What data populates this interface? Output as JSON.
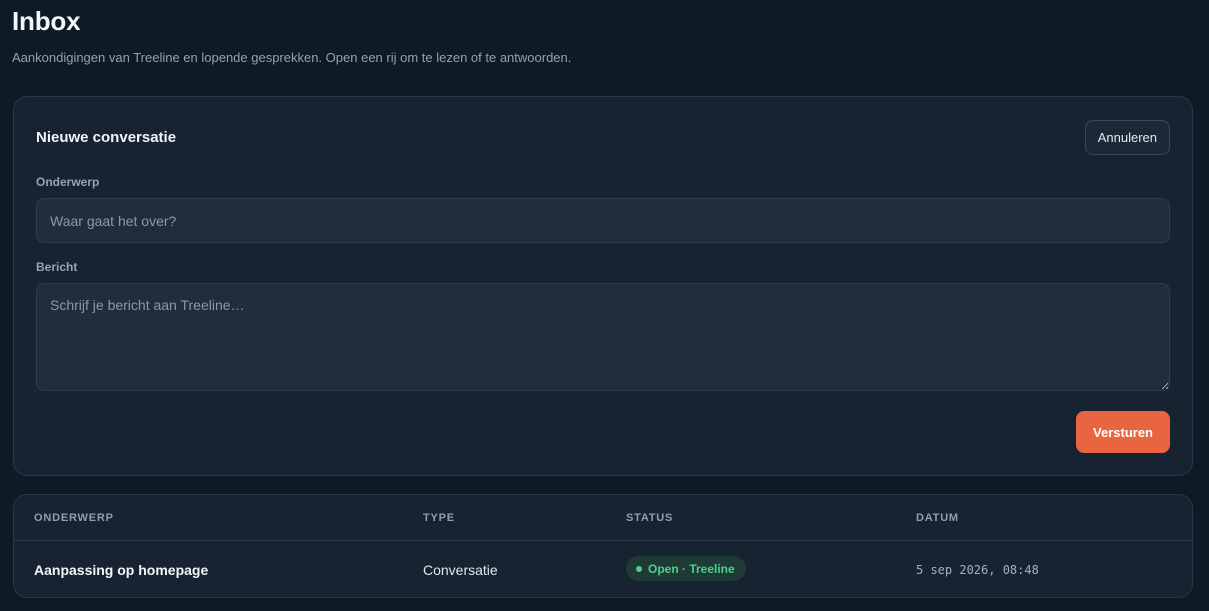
{
  "page": {
    "title": "Inbox",
    "subtitle": "Aankondigingen van Treeline en lopende gesprekken. Open een rij om te lezen of te antwoorden."
  },
  "compose": {
    "title": "Nieuwe conversatie",
    "cancel_label": "Annuleren",
    "subject_label": "Onderwerp",
    "subject_placeholder": "Waar gaat het over?",
    "message_label": "Bericht",
    "message_placeholder": "Schrijf je bericht aan Treeline…",
    "send_label": "Versturen"
  },
  "table": {
    "columns": [
      "ONDERWERP",
      "TYPE",
      "STATUS",
      "DATUM"
    ],
    "rows": [
      {
        "subject": "Aanpassing op homepage",
        "type": "Conversatie",
        "status": "Open · Treeline",
        "date": "5 sep 2026, 08:48"
      }
    ]
  },
  "colors": {
    "background": "#0f1a27",
    "card": "#172331",
    "accent": "#e9653f",
    "status_open": "#4fd08a"
  }
}
